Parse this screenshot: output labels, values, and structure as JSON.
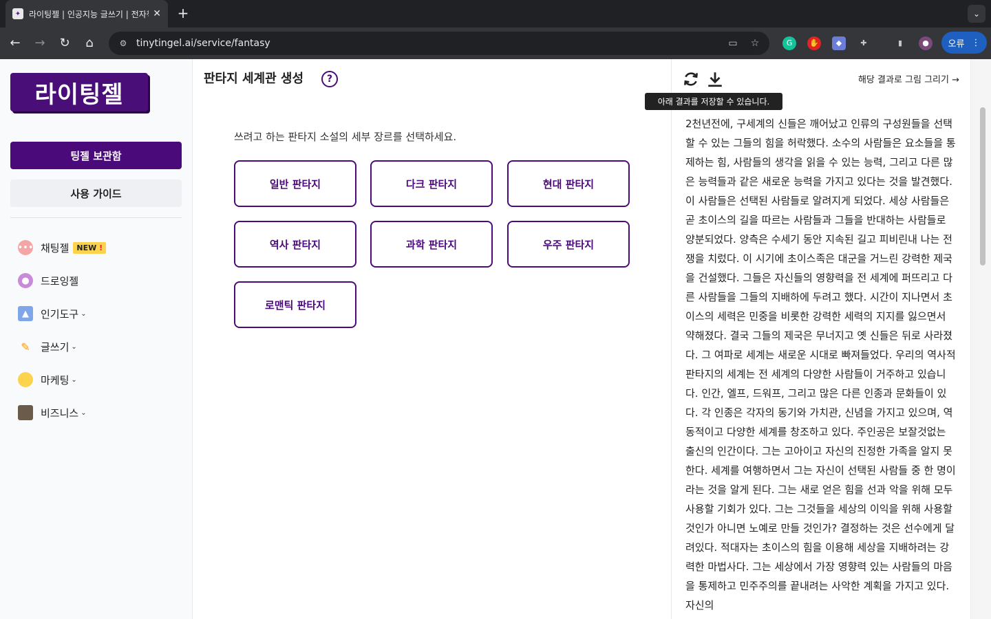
{
  "browser": {
    "tab_title": "라이팅젤 | 인공지능 글쓰기 | 전자책",
    "url": "tinytingel.ai/service/fantasy",
    "profile_label": "오류"
  },
  "sidebar": {
    "logo_text": "라이팅젤",
    "archive_button": "팅젤 보관함",
    "guide_button": "사용 가이드",
    "items": [
      {
        "label": "채팅젤",
        "icon": "chat-bubble-icon",
        "badge": "NEW",
        "badge_mark": "!"
      },
      {
        "label": "드로잉젤",
        "icon": "palette-icon"
      },
      {
        "label": "인기도구",
        "icon": "thumbs-up-icon"
      },
      {
        "label": "글쓰기",
        "icon": "pencil-icon"
      },
      {
        "label": "마케팅",
        "icon": "lightbulb-icon"
      },
      {
        "label": "비즈니스",
        "icon": "briefcase-icon"
      }
    ]
  },
  "main": {
    "title": "판타지 세계관 생성",
    "instruction": "쓰려고 하는 판타지 소설의 세부 장르를 선택하세요.",
    "genres": [
      "일반 판타지",
      "다크 판타지",
      "현대 판타지",
      "역사 판타지",
      "과학 판타지",
      "우주 판타지",
      "로맨틱 판타지"
    ]
  },
  "result": {
    "draw_link": "해당 결과로 그림 그리기 →",
    "tooltip": "아래 결과를 저장할 수 있습니다.",
    "text": "2천년전에, 구세계의 신들은 깨어났고 인류의 구성원들을 선택할 수 있는 그들의 힘을 허락했다. 소수의 사람들은 요소들을 통제하는 힘, 사람들의 생각을 읽을 수 있는 능력, 그리고 다른 많은 능력들과 같은 새로운 능력을 가지고 있다는 것을 발견했다. 이 사람들은 선택된 사람들로 알려지게 되었다. 세상 사람들은 곧 초이스의 길을 따르는 사람들과 그들을 반대하는 사람들로 양분되었다. 양측은 수세기 동안 지속된 길고 피비린내 나는 전쟁을 치렀다. 이 시기에 초이스족은 대군을 거느린 강력한 제국을 건설했다. 그들은 자신들의 영향력을 전 세계에 퍼뜨리고 다른 사람들을 그들의 지배하에 두려고 했다. 시간이 지나면서 초이스의 세력은 민중을 비롯한 강력한 세력의 지지를 잃으면서 약해졌다. 결국 그들의 제국은 무너지고 옛 신들은 뒤로 사라졌다. 그 여파로 세계는 새로운 시대로 빠져들었다. 우리의 역사적 판타지의 세계는 전 세계의 다양한 사람들이 거주하고 있습니다. 인간, 엘프, 드워프, 그리고 많은 다른 인종과 문화들이 있다. 각 인종은 각자의 동기와 가치관, 신념을 가지고 있으며, 역동적이고 다양한 세계를 창조하고 있다. 주인공은 보잘것없는 출신의 인간이다. 그는 고아이고 자신의 진정한 가족을 알지 못한다. 세계를 여행하면서 그는 자신이 선택된 사람들 중 한 명이라는 것을 알게 된다. 그는 새로 얻은 힘을 선과 악을 위해 모두 사용할 기회가 있다. 그는 그것들을 세상의 이익을 위해 사용할 것인가 아니면 노예로 만들 것인가? 결정하는 것은 선수에게 달려있다. 적대자는 초이스의 힘을 이용해 세상을 지배하려는 강력한 마법사다. 그는 세상에서 가장 영향력 있는 사람들의 마음을 통제하고 민주주의를 끝내려는 사악한 계획을 가지고 있다. 자신의"
  },
  "colors": {
    "brand_purple": "#4a0a7a",
    "badge_yellow": "#fcd34d",
    "chrome_dark": "#202124"
  }
}
